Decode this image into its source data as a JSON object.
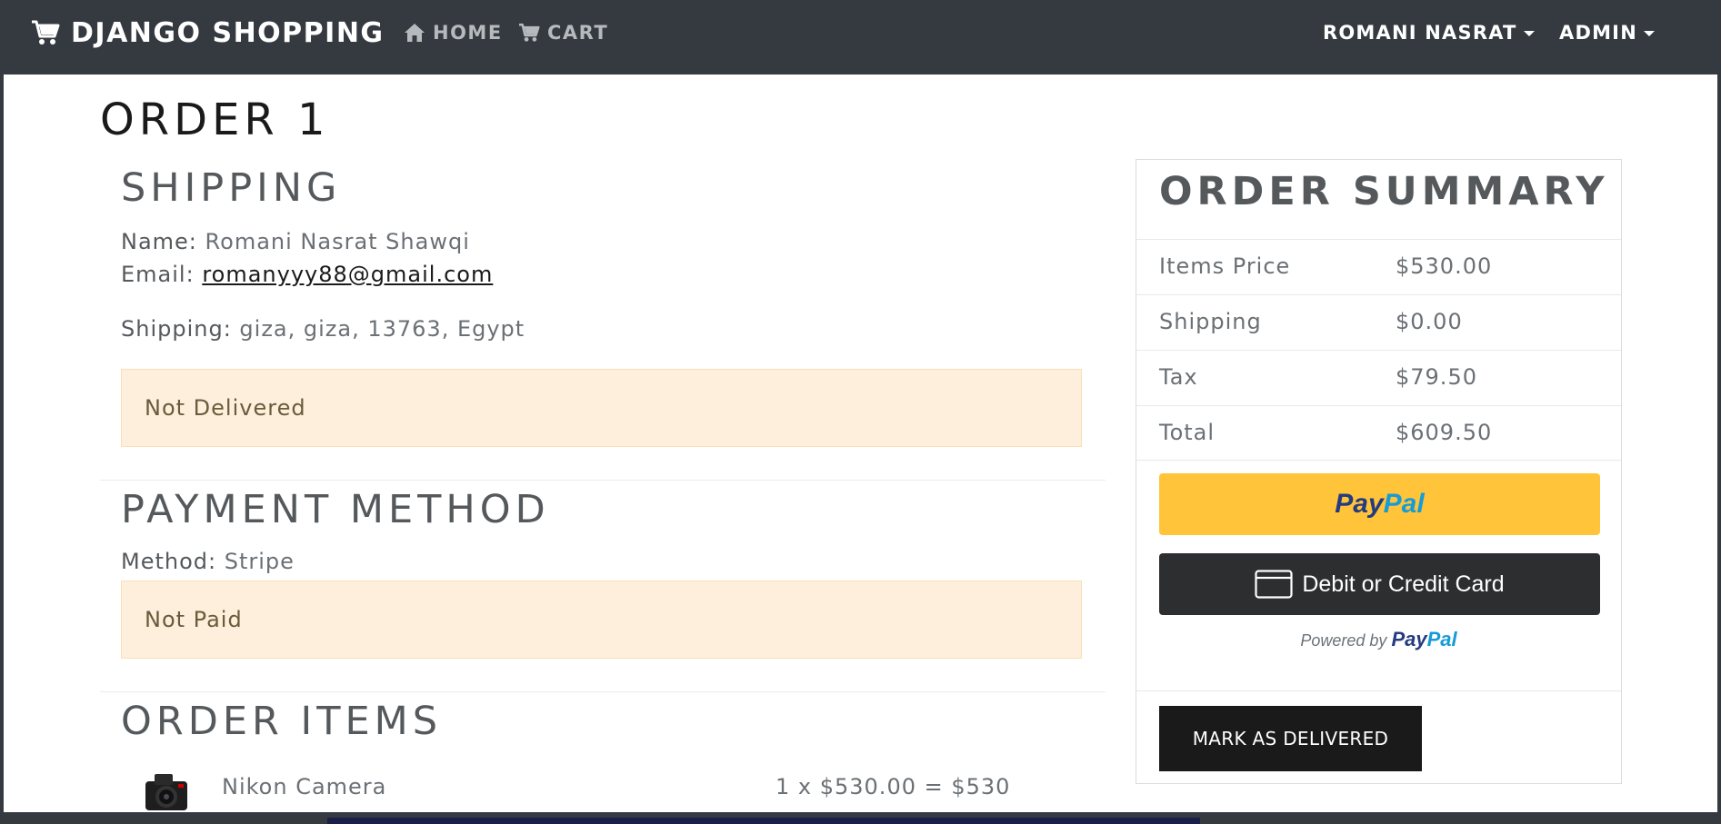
{
  "navbar": {
    "brand": "DJANGO SHOPPING",
    "home": "HOME",
    "cart": "CART",
    "user": "ROMANI NASRAT",
    "admin": "ADMIN"
  },
  "page": {
    "title": "ORDER 1"
  },
  "shipping": {
    "heading": "SHIPPING",
    "name_label": "Name:",
    "name": "Romani Nasrat Shawqi",
    "email_label": "Email:",
    "email": "romanyyy88@gmail.com",
    "address_label": "Shipping:",
    "address": "giza, giza, 13763, Egypt",
    "status": "Not Delivered"
  },
  "payment": {
    "heading": "PAYMENT METHOD",
    "method_label": "Method:",
    "method": "Stripe",
    "status": "Not Paid"
  },
  "order_items": {
    "heading": "ORDER ITEMS",
    "items": [
      {
        "name": "Nikon Camera",
        "calc": "1 x $530.00 = $530"
      }
    ]
  },
  "summary": {
    "heading": "ORDER SUMMARY",
    "rows": [
      {
        "label": "Items Price",
        "value": "$530.00"
      },
      {
        "label": "Shipping",
        "value": "$0.00"
      },
      {
        "label": "Tax",
        "value": "$79.50"
      },
      {
        "label": "Total",
        "value": "$609.50"
      }
    ],
    "paypal_pay": "Pay",
    "paypal_pal": "Pal",
    "card_button": "Debit or Credit Card",
    "powered_by": "Powered by",
    "mark_delivered": "MARK AS DELIVERED"
  },
  "colors": {
    "navbar": "#343a40",
    "alert_bg": "#fdefdc",
    "paypal_yellow": "#ffc439",
    "paypal_dark_blue": "#253b80",
    "paypal_light_blue": "#179bd7",
    "card_button_bg": "#2c2e2f",
    "primary_button_bg": "#1a1a1a"
  },
  "icons": {
    "brand": "shopping-cart-icon",
    "home": "home-icon",
    "cart": "cart-icon",
    "user_menu": "caret-down-icon",
    "admin_menu": "caret-down-icon",
    "card": "credit-card-icon",
    "item_image": "camera-image"
  }
}
